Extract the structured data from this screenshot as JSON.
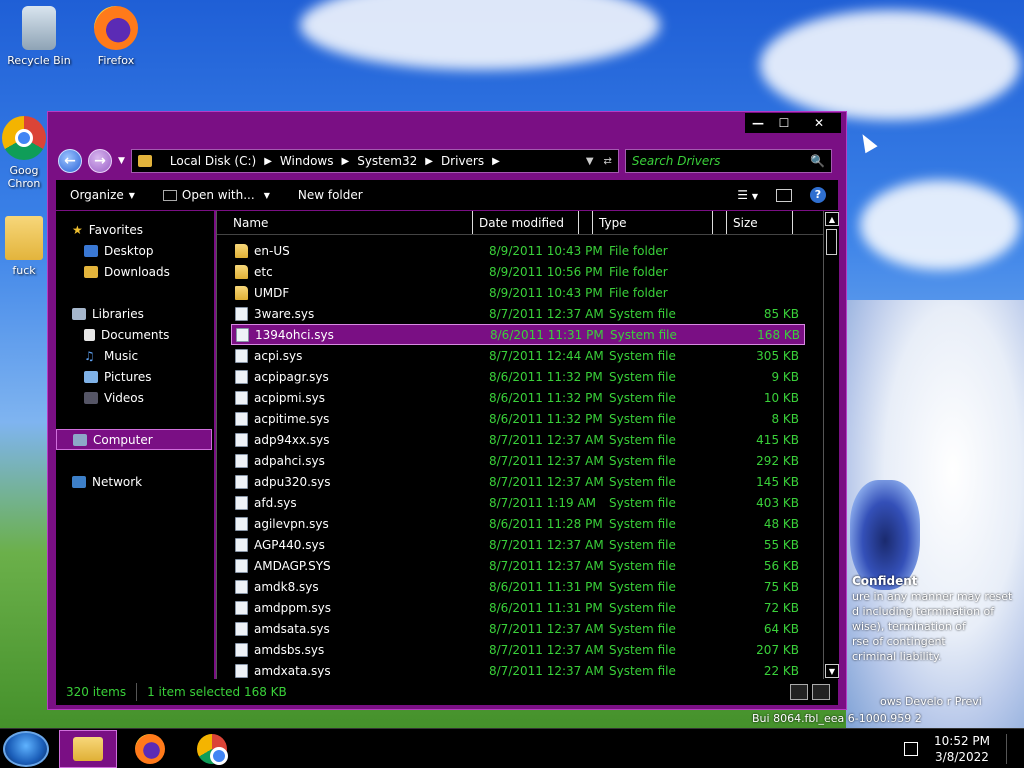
{
  "desktop": {
    "icons": [
      {
        "label": "Recycle Bin"
      },
      {
        "label": "Firefox"
      },
      {
        "label": "Goog Chron"
      },
      {
        "label": "fuck"
      }
    ],
    "watermark": {
      "heading": "Confident",
      "lines": [
        "ure in any manner may reset",
        "d including termination of",
        "wise), termination of",
        "rse of contingent",
        "criminal liability."
      ],
      "build_line1": "ows Develo  r Previ",
      "build_line2": "Bui 8064.fbl_eea  6-1000.959  2"
    }
  },
  "window": {
    "caption": {
      "minimize": "—",
      "maximize": "☐",
      "close": "✕"
    },
    "address": {
      "segments": [
        "Local Disk (C:)",
        "Windows",
        "System32",
        "Drivers"
      ]
    },
    "search_placeholder": "Search Drivers",
    "toolbar": {
      "organize": "Organize",
      "open_with": "Open with...",
      "new_folder": "New folder"
    },
    "nav": {
      "favorites": "Favorites",
      "desktop": "Desktop",
      "downloads": "Downloads",
      "libraries": "Libraries",
      "documents": "Documents",
      "music": "Music",
      "pictures": "Pictures",
      "videos": "Videos",
      "computer": "Computer",
      "network": "Network"
    },
    "columns": {
      "name": "Name",
      "date": "Date modified",
      "type": "Type",
      "size": "Size"
    },
    "files": [
      {
        "name": "en-US",
        "date": "8/9/2011 10:43 PM",
        "type": "File folder",
        "size": "",
        "kind": "folder"
      },
      {
        "name": "etc",
        "date": "8/9/2011 10:56 PM",
        "type": "File folder",
        "size": "",
        "kind": "folder"
      },
      {
        "name": "UMDF",
        "date": "8/9/2011 10:43 PM",
        "type": "File folder",
        "size": "",
        "kind": "folder"
      },
      {
        "name": "3ware.sys",
        "date": "8/7/2011 12:37 AM",
        "type": "System file",
        "size": "85 KB",
        "kind": "sys"
      },
      {
        "name": "1394ohci.sys",
        "date": "8/6/2011 11:31 PM",
        "type": "System file",
        "size": "168 KB",
        "kind": "sys",
        "selected": true
      },
      {
        "name": "acpi.sys",
        "date": "8/7/2011 12:44 AM",
        "type": "System file",
        "size": "305 KB",
        "kind": "sys"
      },
      {
        "name": "acpipagr.sys",
        "date": "8/6/2011 11:32 PM",
        "type": "System file",
        "size": "9 KB",
        "kind": "sys"
      },
      {
        "name": "acpipmi.sys",
        "date": "8/6/2011 11:32 PM",
        "type": "System file",
        "size": "10 KB",
        "kind": "sys"
      },
      {
        "name": "acpitime.sys",
        "date": "8/6/2011 11:32 PM",
        "type": "System file",
        "size": "8 KB",
        "kind": "sys"
      },
      {
        "name": "adp94xx.sys",
        "date": "8/7/2011 12:37 AM",
        "type": "System file",
        "size": "415 KB",
        "kind": "sys"
      },
      {
        "name": "adpahci.sys",
        "date": "8/7/2011 12:37 AM",
        "type": "System file",
        "size": "292 KB",
        "kind": "sys"
      },
      {
        "name": "adpu320.sys",
        "date": "8/7/2011 12:37 AM",
        "type": "System file",
        "size": "145 KB",
        "kind": "sys"
      },
      {
        "name": "afd.sys",
        "date": "8/7/2011 1:19 AM",
        "type": "System file",
        "size": "403 KB",
        "kind": "sys"
      },
      {
        "name": "agilevpn.sys",
        "date": "8/6/2011 11:28 PM",
        "type": "System file",
        "size": "48 KB",
        "kind": "sys"
      },
      {
        "name": "AGP440.sys",
        "date": "8/7/2011 12:37 AM",
        "type": "System file",
        "size": "55 KB",
        "kind": "sys"
      },
      {
        "name": "AMDAGP.SYS",
        "date": "8/7/2011 12:37 AM",
        "type": "System file",
        "size": "56 KB",
        "kind": "sys"
      },
      {
        "name": "amdk8.sys",
        "date": "8/6/2011 11:31 PM",
        "type": "System file",
        "size": "75 KB",
        "kind": "sys"
      },
      {
        "name": "amdppm.sys",
        "date": "8/6/2011 11:31 PM",
        "type": "System file",
        "size": "72 KB",
        "kind": "sys"
      },
      {
        "name": "amdsata.sys",
        "date": "8/7/2011 12:37 AM",
        "type": "System file",
        "size": "64 KB",
        "kind": "sys"
      },
      {
        "name": "amdsbs.sys",
        "date": "8/7/2011 12:37 AM",
        "type": "System file",
        "size": "207 KB",
        "kind": "sys"
      },
      {
        "name": "amdxata.sys",
        "date": "8/7/2011 12:37 AM",
        "type": "System file",
        "size": "22 KB",
        "kind": "sys"
      }
    ],
    "status": {
      "items": "320 items",
      "selected": "1 item selected  168 KB"
    }
  },
  "taskbar": {
    "time": "10:52 PM",
    "date": "3/8/2022"
  },
  "colors": {
    "accent": "#7a0f84",
    "text_green": "#3ad13a"
  }
}
